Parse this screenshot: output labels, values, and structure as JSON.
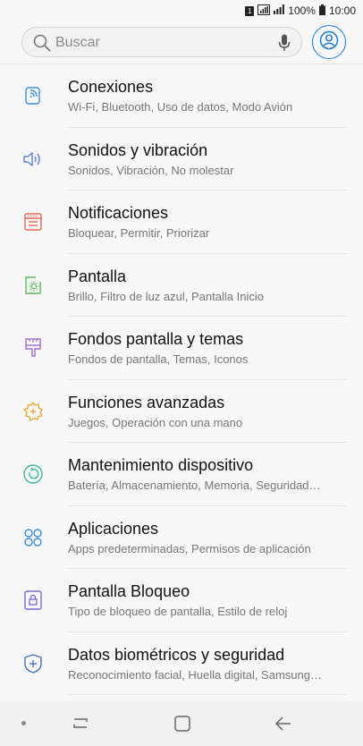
{
  "status": {
    "sim": "1",
    "battery": "100%",
    "time": "10:00"
  },
  "search": {
    "placeholder": "Buscar"
  },
  "items": [
    {
      "title": "Conexiones",
      "subtitle": "Wi-Fi, Bluetooth, Uso de datos, Modo Avión",
      "icon": "connections-icon",
      "color": "#3b8fd6"
    },
    {
      "title": "Sonidos y vibración",
      "subtitle": "Sonidos, Vibración, No molestar",
      "icon": "speaker-icon",
      "color": "#5a7fcf"
    },
    {
      "title": "Notificaciones",
      "subtitle": "Bloquear, Permitir, Priorizar",
      "icon": "notifications-icon",
      "color": "#e4685a"
    },
    {
      "title": "Pantalla",
      "subtitle": "Brillo, Filtro de luz azul, Pantalla Inicio",
      "icon": "display-icon",
      "color": "#5cb85c"
    },
    {
      "title": "Fondos pantalla y temas",
      "subtitle": "Fondos de pantalla, Temas, Iconos",
      "icon": "brush-icon",
      "color": "#a56cc9"
    },
    {
      "title": "Funciones avanzadas",
      "subtitle": "Juegos, Operación con una mano",
      "icon": "puzzle-gear-icon",
      "color": "#e6a82e"
    },
    {
      "title": "Mantenimiento dispositivo",
      "subtitle": "Batería, Almacenamiento, Memoria, Seguridad…",
      "icon": "refresh-circle-icon",
      "color": "#3fb39c"
    },
    {
      "title": "Aplicaciones",
      "subtitle": "Apps predeterminadas, Permisos de aplicación",
      "icon": "apps-grid-icon",
      "color": "#3b8fd6"
    },
    {
      "title": "Pantalla Bloqueo",
      "subtitle": "Tipo de bloqueo de pantalla, Estilo de reloj",
      "icon": "lock-icon",
      "color": "#7a6ccf"
    },
    {
      "title": "Datos biométricos y seguridad",
      "subtitle": "Reconocimiento facial, Huella digital, Samsung…",
      "icon": "shield-icon",
      "color": "#4a6fb5"
    }
  ],
  "colors": {
    "accent": "#1a7bd6",
    "background": "#f7f7f7"
  }
}
